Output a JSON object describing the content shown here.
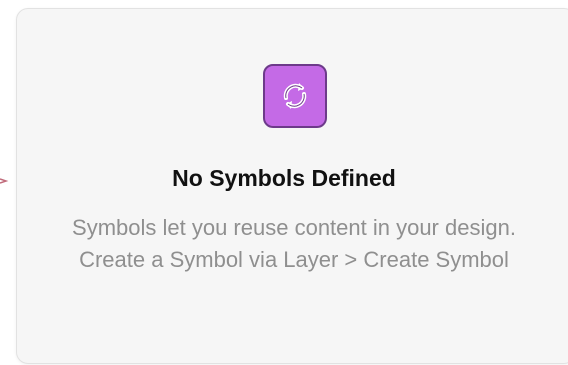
{
  "empty_state": {
    "icon": "sync-arrows-icon",
    "title": "No Symbols Defined",
    "description": "Symbols let you reuse content in your design. Create a Symbol via Layer > Create Symbol"
  },
  "colors": {
    "icon_fill": "#c46ae6",
    "icon_border": "#6d3a8a",
    "title": "#111111",
    "description": "#8f8f8f",
    "panel_bg": "#f6f6f6"
  }
}
